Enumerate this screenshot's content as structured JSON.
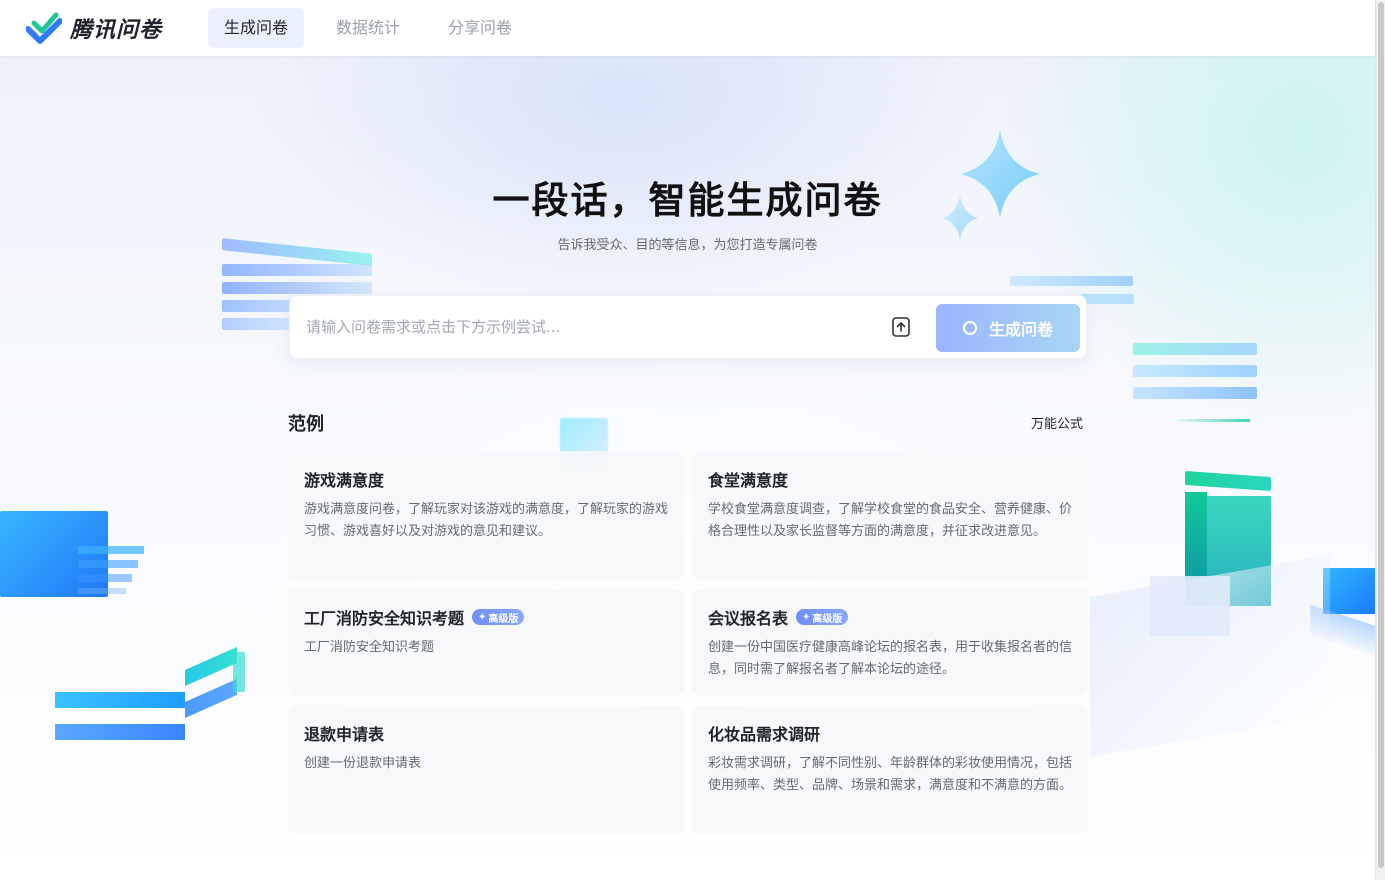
{
  "header": {
    "brand": "腾讯问卷",
    "nav": [
      {
        "label": "生成问卷",
        "active": true
      },
      {
        "label": "数据统计",
        "active": false
      },
      {
        "label": "分享问卷",
        "active": false
      }
    ]
  },
  "hero": {
    "title": "一段话，智能生成问卷",
    "subtitle": "告诉我受众、目的等信息，为您打造专属问卷"
  },
  "input": {
    "placeholder": "请输入问卷需求或点击下方示例尝试...",
    "upload_icon": "upload-icon",
    "generate_label": "生成问卷"
  },
  "examples": {
    "title": "范例",
    "formula_link": "万能公式",
    "badge_label": "高级版",
    "cards": [
      {
        "title": "游戏满意度",
        "desc": "游戏满意度问卷，了解玩家对该游戏的满意度，了解玩家的游戏习惯、游戏喜好以及对游戏的意见和建议。",
        "badge": false
      },
      {
        "title": "食堂满意度",
        "desc": "学校食堂满意度调查，了解学校食堂的食品安全、营养健康、价格合理性以及家长监督等方面的满意度，并征求改进意见。",
        "badge": false
      },
      {
        "title": "工厂消防安全知识考题",
        "desc": "工厂消防安全知识考题",
        "badge": true
      },
      {
        "title": "会议报名表",
        "desc": "创建一份中国医疗健康高峰论坛的报名表，用于收集报名者的信息，同时需了解报名者了解本论坛的途径。",
        "badge": true
      },
      {
        "title": "退款申请表",
        "desc": "创建一份退款申请表",
        "badge": false
      },
      {
        "title": "化妆品需求调研",
        "desc": "彩妆需求调研，了解不同性别、年龄群体的彩妆使用情况，包括使用频率、类型、品牌、场景和需求，满意度和不满意的方面。",
        "badge": false
      }
    ]
  },
  "colors": {
    "accent": "#2f7cf6",
    "nav_active_bg": "#eaf1fd",
    "button_gradient_start": "#9cb4ff",
    "button_gradient_end": "#a8d6f2"
  }
}
